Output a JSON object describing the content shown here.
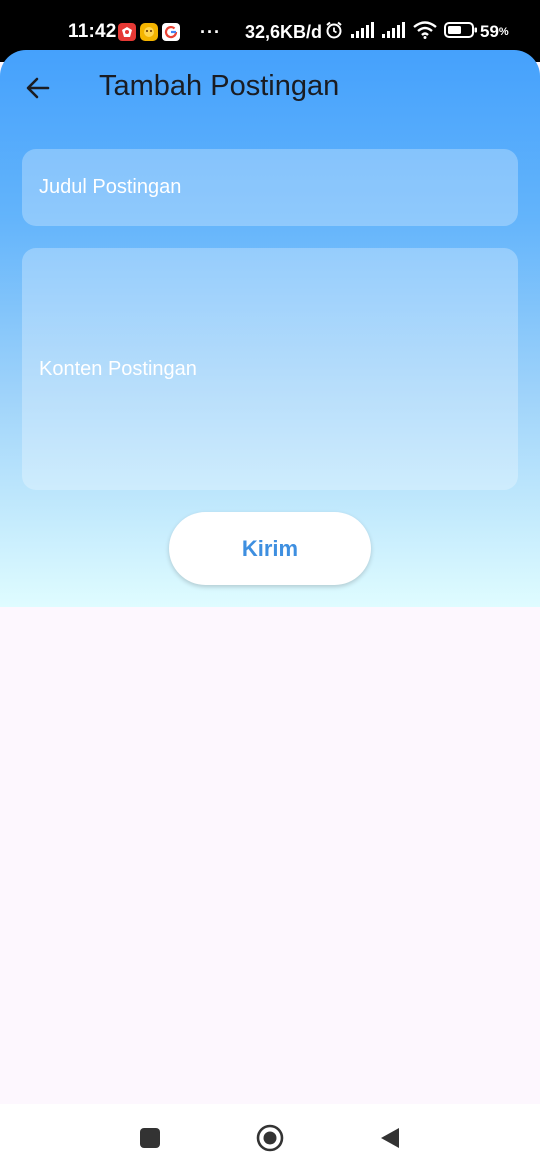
{
  "status_bar": {
    "time": "11:42",
    "dots": "···",
    "network_speed": "32,6KB/d",
    "battery_percent": "59",
    "battery_unit": "%",
    "battery_level": 0.59,
    "notification_icons": [
      "red-app-icon",
      "game-app-icon",
      "google-icon"
    ],
    "system_icons": [
      "alarm-icon",
      "signal-icon",
      "signal-icon",
      "wifi-icon",
      "battery-icon"
    ]
  },
  "app_bar": {
    "title": "Tambah Postingan",
    "back_icon": "arrow-left-icon"
  },
  "form": {
    "title_placeholder": "Judul Postingan",
    "content_placeholder": "Konten Postingan",
    "submit_label": "Kirim"
  },
  "colors": {
    "gradient_top": "#45a1fc",
    "gradient_bottom": "#dffcff",
    "button_text": "#3e8fe0",
    "page_background": "#fdf7fe"
  },
  "nav_bar": {
    "buttons": [
      "recents-square-icon",
      "home-circle-icon",
      "back-triangle-icon"
    ]
  }
}
